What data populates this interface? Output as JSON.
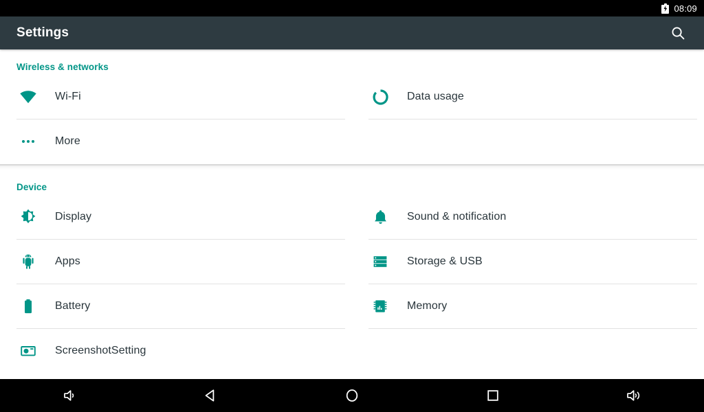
{
  "status_bar": {
    "time": "08:09",
    "battery_icon": "battery-charging-icon"
  },
  "action_bar": {
    "title": "Settings",
    "search_icon": "search-icon"
  },
  "theme": {
    "accent": "#009587",
    "action_bar_bg": "#2e3b41",
    "status_bar_bg": "#000000",
    "label_color": "#29353b",
    "divider": "#e2e2e2"
  },
  "sections": [
    {
      "title": "Wireless & networks",
      "items": [
        {
          "label": "Wi-Fi",
          "icon": "wifi-icon"
        },
        {
          "label": "Data usage",
          "icon": "data-usage-icon"
        },
        {
          "label": "More",
          "icon": "more-dots-icon"
        }
      ]
    },
    {
      "title": "Device",
      "items": [
        {
          "label": "Display",
          "icon": "brightness-icon"
        },
        {
          "label": "Sound & notification",
          "icon": "bell-icon"
        },
        {
          "label": "Apps",
          "icon": "android-robot-icon"
        },
        {
          "label": "Storage & USB",
          "icon": "storage-icon"
        },
        {
          "label": "Battery",
          "icon": "battery-icon"
        },
        {
          "label": "Memory",
          "icon": "memory-chip-icon"
        },
        {
          "label": "ScreenshotSetting",
          "icon": "camera-icon"
        }
      ]
    }
  ],
  "nav_bar": {
    "buttons": [
      {
        "name": "volume-down-icon"
      },
      {
        "name": "back-icon"
      },
      {
        "name": "home-icon"
      },
      {
        "name": "recents-icon"
      },
      {
        "name": "volume-up-icon"
      }
    ]
  }
}
